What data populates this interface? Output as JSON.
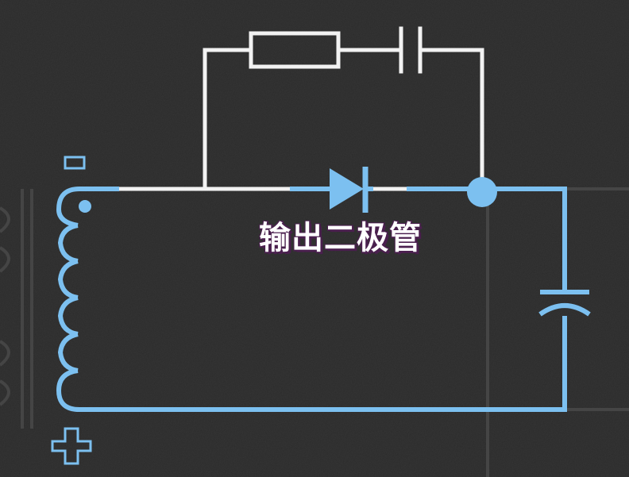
{
  "diagram": {
    "label": "输出二极管",
    "terminal_top_symbol": "minus",
    "terminal_bottom_symbol": "plus",
    "colors": {
      "background": "#2a2a2a",
      "wire_blue": "#7cc0f0",
      "wire_white": "#f2f2f2",
      "ghost_lines": "#454545",
      "label_shadow": "#4a1f4e"
    }
  }
}
